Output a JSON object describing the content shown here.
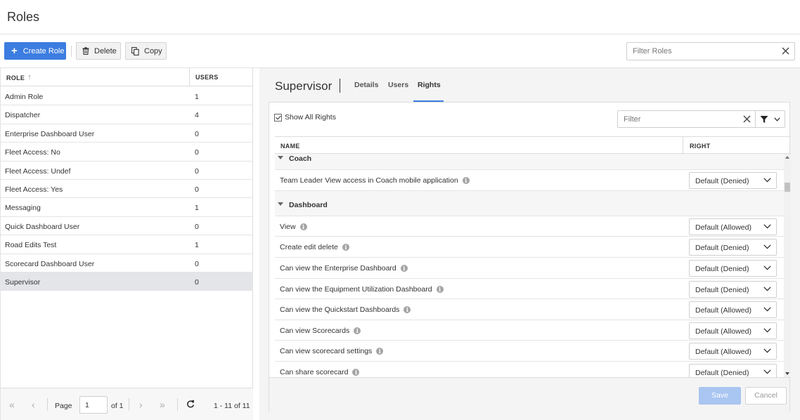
{
  "header": {
    "title": "Roles"
  },
  "toolbar": {
    "create_label": "Create Role",
    "delete_label": "Delete",
    "copy_label": "Copy",
    "filter_placeholder": "Filter Roles",
    "accent": "#3b7de0"
  },
  "roles_table": {
    "col_role": "ROLE",
    "col_users": "USERS",
    "rows": [
      {
        "name": "Admin Role",
        "users": "1"
      },
      {
        "name": "Dispatcher",
        "users": "4"
      },
      {
        "name": "Enterprise Dashboard User",
        "users": "0"
      },
      {
        "name": "Fleet Access: No",
        "users": "0"
      },
      {
        "name": "Fleet Access: Undef",
        "users": "0"
      },
      {
        "name": "Fleet Access: Yes",
        "users": "0"
      },
      {
        "name": "Messaging",
        "users": "1"
      },
      {
        "name": "Quick Dashboard User",
        "users": "0"
      },
      {
        "name": "Road Edits Test",
        "users": "1"
      },
      {
        "name": "Scorecard Dashboard User",
        "users": "0"
      },
      {
        "name": "Supervisor",
        "users": "0"
      }
    ],
    "selected": "Supervisor"
  },
  "pager": {
    "page_label": "Page",
    "page_value": "1",
    "of_label": "of 1",
    "range": "1 - 11 of 11"
  },
  "detail": {
    "title": "Supervisor",
    "tabs": [
      {
        "label": "Details"
      },
      {
        "label": "Users"
      },
      {
        "label": "Rights"
      }
    ],
    "active_tab": "Rights",
    "show_all_label": "Show All Rights",
    "filter_placeholder": "Filter",
    "col_name": "NAME",
    "col_right": "RIGHT",
    "groups": [
      {
        "name": "Coach",
        "rights": [
          {
            "name": "Team Leader View access in Coach mobile application",
            "value": "Default (Denied)"
          }
        ]
      },
      {
        "name": "Dashboard",
        "rights": [
          {
            "name": "View",
            "value": "Default (Allowed)"
          },
          {
            "name": "Create edit delete",
            "value": "Default (Denied)"
          },
          {
            "name": "Can view the Enterprise Dashboard",
            "value": "Default (Denied)"
          },
          {
            "name": "Can view the Equipment Utilization Dashboard",
            "value": "Default (Denied)"
          },
          {
            "name": "Can view the Quickstart Dashboards",
            "value": "Default (Allowed)"
          },
          {
            "name": "Can view Scorecards",
            "value": "Default (Allowed)"
          },
          {
            "name": "Can view scorecard settings",
            "value": "Default (Allowed)"
          },
          {
            "name": "Can share scorecard",
            "value": "Default (Denied)"
          }
        ]
      }
    ],
    "save_label": "Save",
    "cancel_label": "Cancel"
  }
}
